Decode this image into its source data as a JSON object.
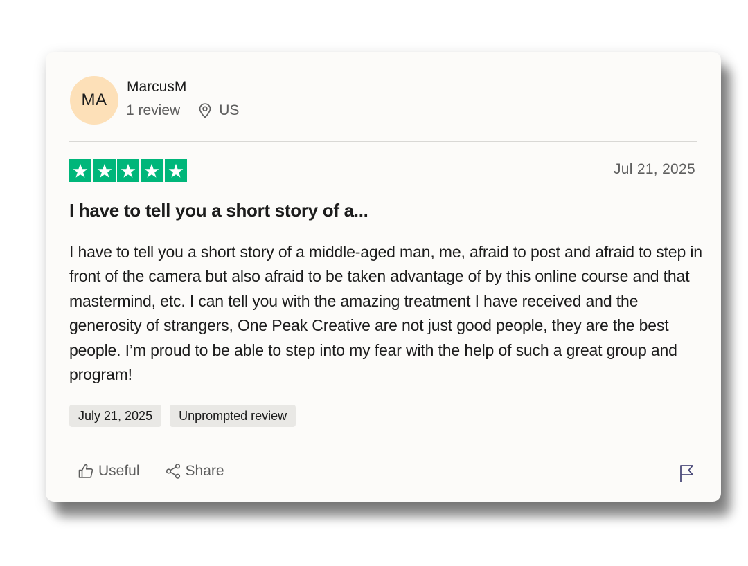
{
  "reviewer": {
    "initials": "MA",
    "name": "MarcusM",
    "review_count": "1 review",
    "country": "US",
    "avatar_color": "#fde0b8"
  },
  "review": {
    "rating": 5,
    "rating_max": 5,
    "star_color": "#00b67a",
    "date": "Jul 21, 2025",
    "title": "I have to tell you a short story of a...",
    "body": "I have to tell you a short story of a middle-aged man, me, afraid to post and afraid to step in front of the camera but also afraid to be taken advantage of by this online course and that mastermind, etc. I can tell you with the amazing treatment I have received and the generosity of strangers, One Peak Creative are not just good people, they are the best people. I’m proud to be able to step into my fear with the help of such a great group and program!",
    "tags": [
      "July 21, 2025",
      "Unprompted review"
    ]
  },
  "actions": {
    "useful_label": "Useful",
    "share_label": "Share",
    "icons": [
      "thumbs-up-icon",
      "share-icon",
      "flag-icon",
      "location-pin-icon",
      "star-icon"
    ]
  }
}
